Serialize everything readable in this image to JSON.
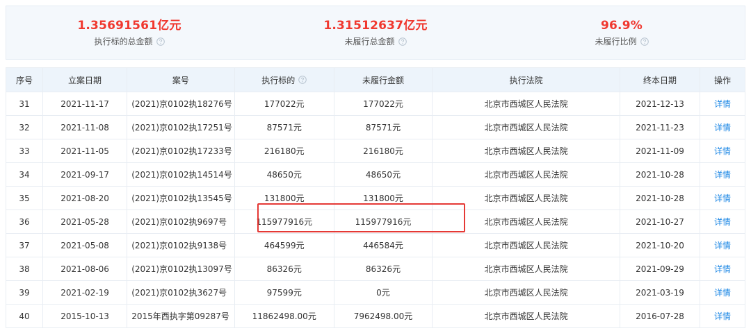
{
  "summary": [
    {
      "value": "1.35691561亿元",
      "label": "执行标的总金额"
    },
    {
      "value": "1.31512637亿元",
      "label": "未履行总金额"
    },
    {
      "value": "96.9%",
      "label": "未履行比例"
    }
  ],
  "table": {
    "headers": {
      "index": "序号",
      "filing_date": "立案日期",
      "case_no": "案号",
      "target": "执行标的",
      "unpaid": "未履行金额",
      "court": "执行法院",
      "end_date": "终本日期",
      "action": "操作"
    },
    "rows": [
      {
        "index": "31",
        "filing_date": "2021-11-17",
        "case_no": "(2021)京0102执18276号",
        "target": "177022元",
        "unpaid": "177022元",
        "court": "北京市西城区人民法院",
        "end_date": "2021-12-13",
        "action": "详情"
      },
      {
        "index": "32",
        "filing_date": "2021-11-08",
        "case_no": "(2021)京0102执17251号",
        "target": "87571元",
        "unpaid": "87571元",
        "court": "北京市西城区人民法院",
        "end_date": "2021-11-23",
        "action": "详情"
      },
      {
        "index": "33",
        "filing_date": "2021-11-05",
        "case_no": "(2021)京0102执17233号",
        "target": "216180元",
        "unpaid": "216180元",
        "court": "北京市西城区人民法院",
        "end_date": "2021-11-09",
        "action": "详情"
      },
      {
        "index": "34",
        "filing_date": "2021-09-17",
        "case_no": "(2021)京0102执14514号",
        "target": "48650元",
        "unpaid": "48650元",
        "court": "北京市西城区人民法院",
        "end_date": "2021-10-28",
        "action": "详情"
      },
      {
        "index": "35",
        "filing_date": "2021-08-20",
        "case_no": "(2021)京0102执13545号",
        "target": "131800元",
        "unpaid": "131800元",
        "court": "北京市西城区人民法院",
        "end_date": "2021-10-28",
        "action": "详情"
      },
      {
        "index": "36",
        "filing_date": "2021-05-28",
        "case_no": "(2021)京0102执9697号",
        "target": "115977916元",
        "unpaid": "115977916元",
        "court": "北京市西城区人民法院",
        "end_date": "2021-10-27",
        "action": "详情"
      },
      {
        "index": "37",
        "filing_date": "2021-05-08",
        "case_no": "(2021)京0102执9138号",
        "target": "464599元",
        "unpaid": "446584元",
        "court": "北京市西城区人民法院",
        "end_date": "2021-10-20",
        "action": "详情"
      },
      {
        "index": "38",
        "filing_date": "2021-08-06",
        "case_no": "(2021)京0102执13097号",
        "target": "86326元",
        "unpaid": "86326元",
        "court": "北京市西城区人民法院",
        "end_date": "2021-09-29",
        "action": "详情"
      },
      {
        "index": "39",
        "filing_date": "2021-02-19",
        "case_no": "(2021)京0102执3627号",
        "target": "97599元",
        "unpaid": "0元",
        "court": "北京市西城区人民法院",
        "end_date": "2021-03-19",
        "action": "详情"
      },
      {
        "index": "40",
        "filing_date": "2015-10-13",
        "case_no": "2015年西执字第09287号",
        "target": "11862498.00元",
        "unpaid": "7962498.00元",
        "court": "北京市西城区人民法院",
        "end_date": "2016-07-28",
        "action": "详情"
      }
    ]
  },
  "colors": {
    "accent_red": "#f0382f",
    "link_blue": "#1e88e5",
    "header_bg": "#edf4fb",
    "highlight_border": "#e53935"
  },
  "icons": {
    "help": "question-circle-icon"
  }
}
